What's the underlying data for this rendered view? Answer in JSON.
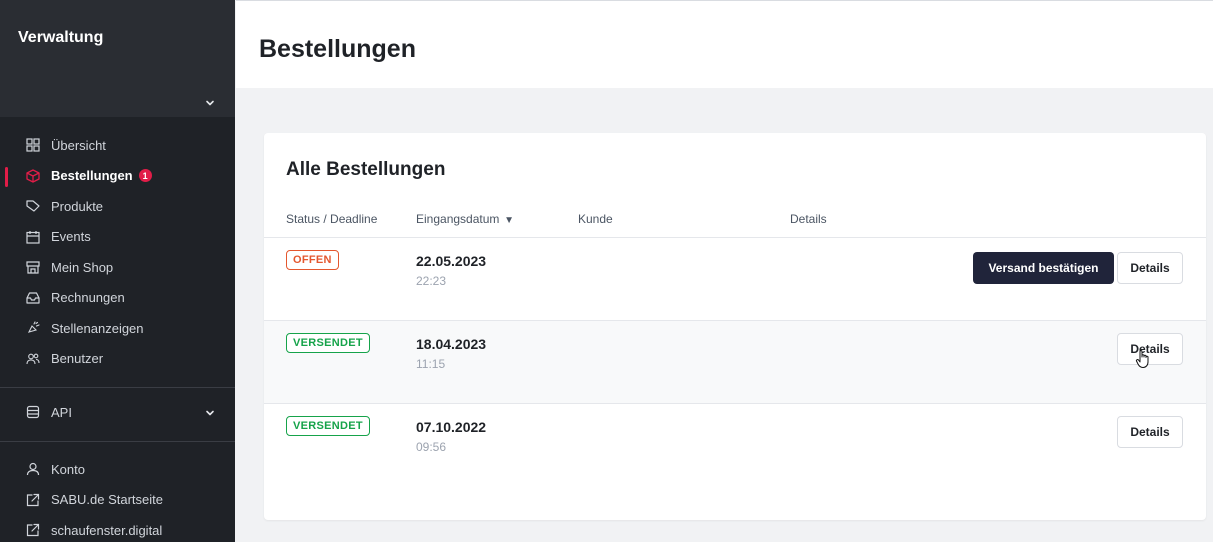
{
  "sidebar": {
    "title": "Verwaltung",
    "items": [
      {
        "label": "Übersicht",
        "icon": "grid-icon"
      },
      {
        "label": "Bestellungen",
        "icon": "box-icon",
        "badge": "1",
        "active": true
      },
      {
        "label": "Produkte",
        "icon": "tag-icon"
      },
      {
        "label": "Events",
        "icon": "calendar-icon"
      },
      {
        "label": "Mein Shop",
        "icon": "store-icon"
      },
      {
        "label": "Rechnungen",
        "icon": "inbox-icon"
      },
      {
        "label": "Stellenanzeigen",
        "icon": "megaphone-icon"
      },
      {
        "label": "Benutzer",
        "icon": "users-icon"
      }
    ],
    "api": {
      "label": "API",
      "icon": "database-icon"
    },
    "bottom_items": [
      {
        "label": "Konto",
        "icon": "user-icon"
      },
      {
        "label": "SABU.de Startseite",
        "icon": "external-link-icon"
      },
      {
        "label": "schaufenster.digital",
        "icon": "external-link-icon"
      }
    ]
  },
  "header": {
    "title": "Bestellungen"
  },
  "orders": {
    "title": "Alle Bestellungen",
    "columns": {
      "status": "Status / Deadline",
      "date": "Eingangsdatum",
      "customer": "Kunde",
      "details": "Details"
    },
    "rows": [
      {
        "status": "OFFEN",
        "date": "22.05.2023",
        "time": "22:23",
        "confirm_label": "Versand bestätigen",
        "details_label": "Details"
      },
      {
        "status": "VERSENDET",
        "date": "18.04.2023",
        "time": "11:15",
        "details_label": "Details"
      },
      {
        "status": "VERSENDET",
        "date": "07.10.2022",
        "time": "09:56",
        "details_label": "Details"
      }
    ]
  },
  "colors": {
    "accent": "#e11d48",
    "open": "#e4572e",
    "shipped": "#16a34a",
    "primary_button": "#20243a"
  }
}
